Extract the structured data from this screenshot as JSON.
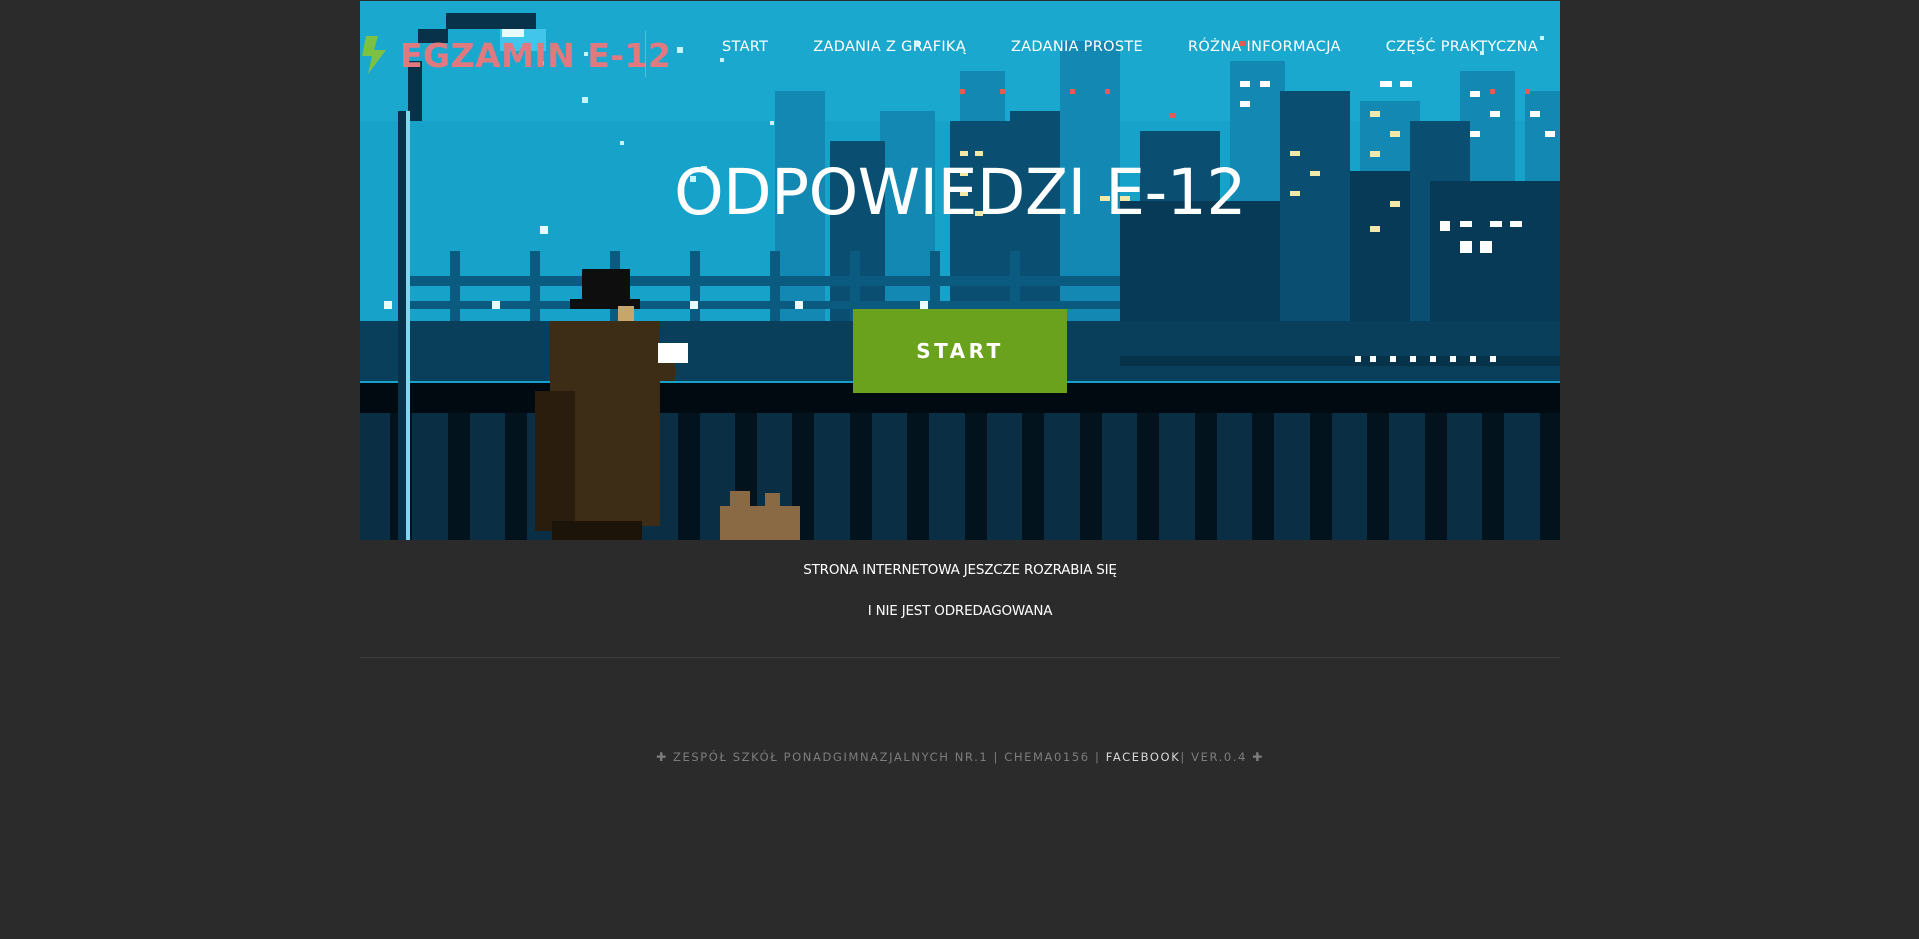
{
  "brand": {
    "name": "EGZAMIN E-12",
    "color": "#e07a7f",
    "icon": "lightning-bolt-icon"
  },
  "nav": {
    "items": [
      {
        "label": "START"
      },
      {
        "label": "ZADANIA Z GRAFIKĄ"
      },
      {
        "label": "ZADANIA PROSTE"
      },
      {
        "label": "RÓŻNA INFORMACJA"
      },
      {
        "label": "CZĘŚĆ PRAKTYCZNA"
      }
    ]
  },
  "hero": {
    "title": "ODPOWIEDZI E-12",
    "button_label": "START",
    "button_color": "#6aa11d",
    "background": "pixel-art-night-city"
  },
  "notice": {
    "line1": "STRONA INTERNETOWA JESZCZE ROZRABIA SIĘ",
    "line2": "I NIE JEST ODREDAGOWANA"
  },
  "footer": {
    "left_glyph": "✚",
    "school": "ZESPÓŁ SZKÓŁ PONADGIMNAZJALNYCH NR.1",
    "sep1": "|",
    "author": "CHEMA0156",
    "sep2": "|",
    "facebook": "FACEBOOK",
    "sep3": "|",
    "version": "VER.0.4",
    "right_glyph": "✚"
  },
  "colors": {
    "page_bg": "#2b2b2b",
    "hero_sky": "#17a3c9"
  }
}
